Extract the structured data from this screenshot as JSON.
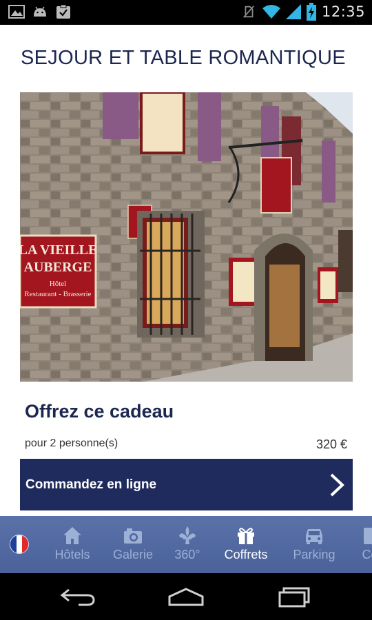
{
  "status_bar": {
    "time": "12:35",
    "left_icons": [
      "image-icon",
      "android-icon",
      "clipboard-check-icon"
    ],
    "right_icons": [
      "no-sim-icon",
      "wifi-icon",
      "signal-icon",
      "battery-charging-icon"
    ]
  },
  "main": {
    "title": "SEJOUR ET TABLE ROMANTIQUE",
    "hero_image": "restaurant-facade-photo",
    "hero_signs": {
      "wall_sign_line1": "LA VIEILLE",
      "wall_sign_line2": "AUBERGE",
      "wall_sign_line3": "Hôtel",
      "wall_sign_line4": "Restaurant - Brasserie"
    },
    "gift_title": "Offrez ce cadeau",
    "persons": "pour 2 personne(s)",
    "price": "320 €",
    "order_label": "Commandez en ligne"
  },
  "nav": {
    "language": "fr",
    "items": [
      {
        "label": "Hôtels",
        "icon": "home-icon"
      },
      {
        "label": "Galerie",
        "icon": "camera-icon"
      },
      {
        "label": "360°",
        "icon": "fleur-de-lis-icon"
      },
      {
        "label": "Coffrets",
        "icon": "gift-icon",
        "active": true
      },
      {
        "label": "Parking",
        "icon": "car-icon"
      },
      {
        "label": "Co",
        "icon": "contact-icon"
      }
    ]
  },
  "colors": {
    "brand_navy": "#1f2b5c",
    "title_navy": "#1c2750",
    "nav_bar": "#4f669e",
    "nav_inactive": "#9db0d6",
    "nav_active": "#ffffff"
  }
}
